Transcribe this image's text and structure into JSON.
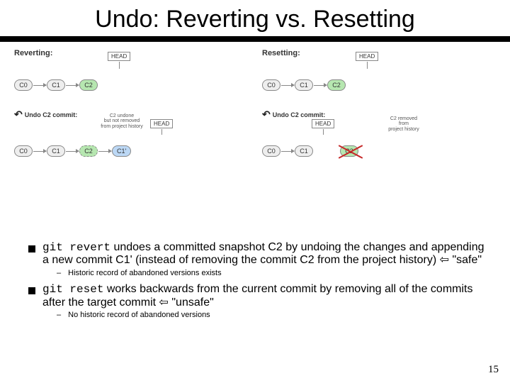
{
  "title": "Undo: Reverting vs. Resetting",
  "diagram": {
    "left_label": "Reverting:",
    "right_label": "Resetting:",
    "head": "HEAD",
    "nodes": {
      "c0": "C0",
      "c1": "C1",
      "c2": "C2",
      "c1p": "C1'"
    },
    "undo_left": "Undo C2 commit:",
    "undo_right": "Undo C2 commit:",
    "note_left": "C2 undone\nbut not removed\nfrom project history",
    "note_right": "C2 removed\nfrom\nproject history"
  },
  "bullets": {
    "revert_cmd": "git revert",
    "revert_text": " undoes a committed snapshot C2 by undoing the changes and appending a new commit C1' (instead of removing the commit C2 from the project history) ",
    "revert_tag": " \"safe\"",
    "revert_sub": "Historic record of abandoned versions exists",
    "reset_cmd": "git reset",
    "reset_text": " works backwards from the current commit by removing all of the commits after the target commit ",
    "reset_tag": " \"unsafe\"",
    "reset_sub": "No historic record of abandoned versions"
  },
  "pagenum": "15",
  "glyph": {
    "arrow": "⇦"
  }
}
